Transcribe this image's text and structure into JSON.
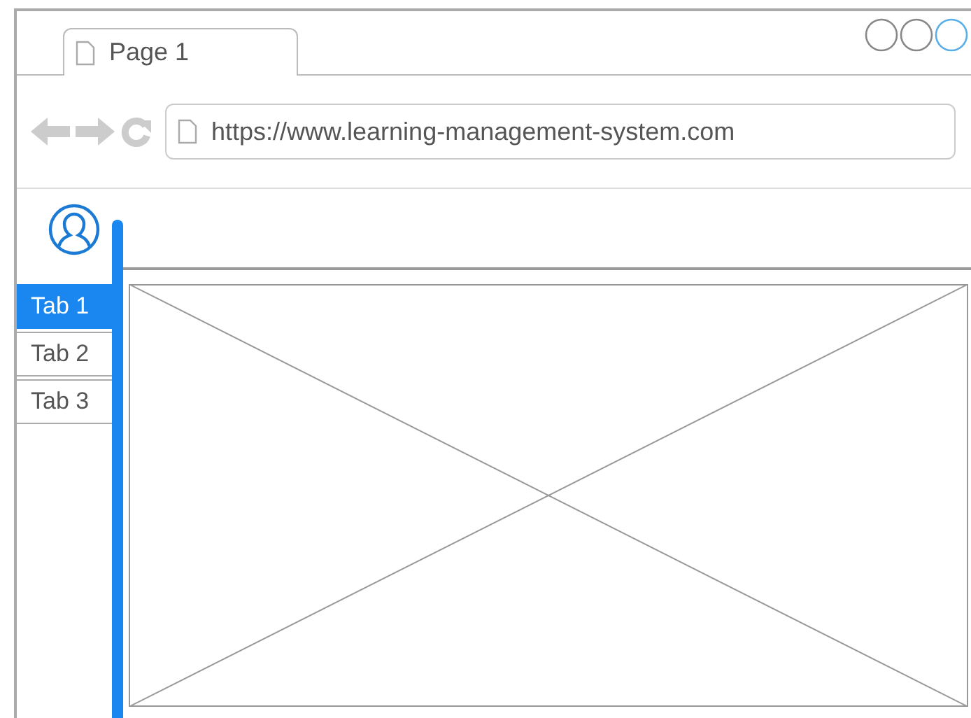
{
  "browser_tab": {
    "title": "Page 1"
  },
  "address_bar": {
    "url": "https://www.learning-management-system.com"
  },
  "side_tabs": [
    {
      "label": "Tab 1",
      "selected": true
    },
    {
      "label": "Tab 2",
      "selected": false
    },
    {
      "label": "Tab 3",
      "selected": false
    }
  ]
}
